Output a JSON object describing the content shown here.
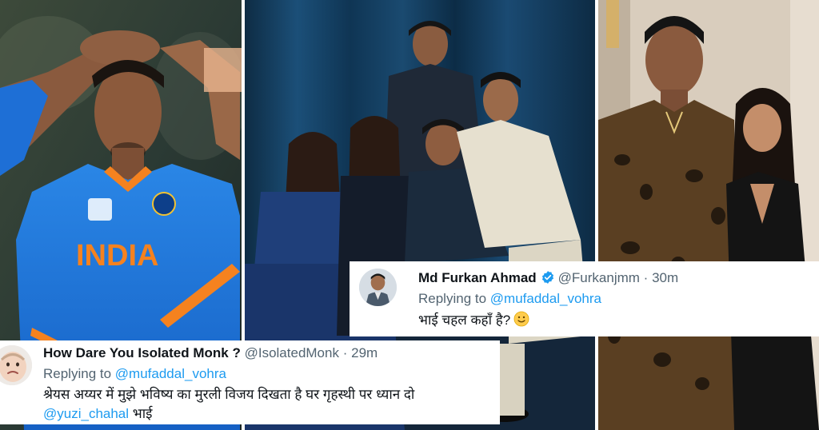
{
  "tweets": {
    "furkan": {
      "name": "Md Furkan Ahmad",
      "handle": "@Furkanjmm",
      "separator": "·",
      "time": "30m",
      "replying_prefix": "Replying to",
      "replying_handle": "@mufaddal_vohra",
      "text": "भाई चहल कहाँ है?",
      "emoji_icon": "smiling-face-icon",
      "verified_icon": "verified-badge-icon"
    },
    "monk": {
      "name": "How Dare You Isolated Monk ?",
      "handle": "@IsolatedMonk",
      "separator": "·",
      "time": "29m",
      "replying_prefix": "Replying to",
      "replying_handle": "@mufaddal_vohra",
      "text_line1": "श्रेयस अय्यर में मुझे भविष्य का मुरली विजय दिखता है घर गृहस्थी पर ध्यान दो",
      "text_line2_mention": "@yuzi_chahal",
      "text_line2_rest": "भाई"
    }
  },
  "photos": {
    "left": {
      "jersey_text": "INDIA"
    }
  },
  "colors": {
    "link": "#1d9bf0",
    "secondary_text": "#536471",
    "primary_text": "#0f1419",
    "india_blue": "#1e73d8",
    "india_orange": "#f5821f"
  }
}
